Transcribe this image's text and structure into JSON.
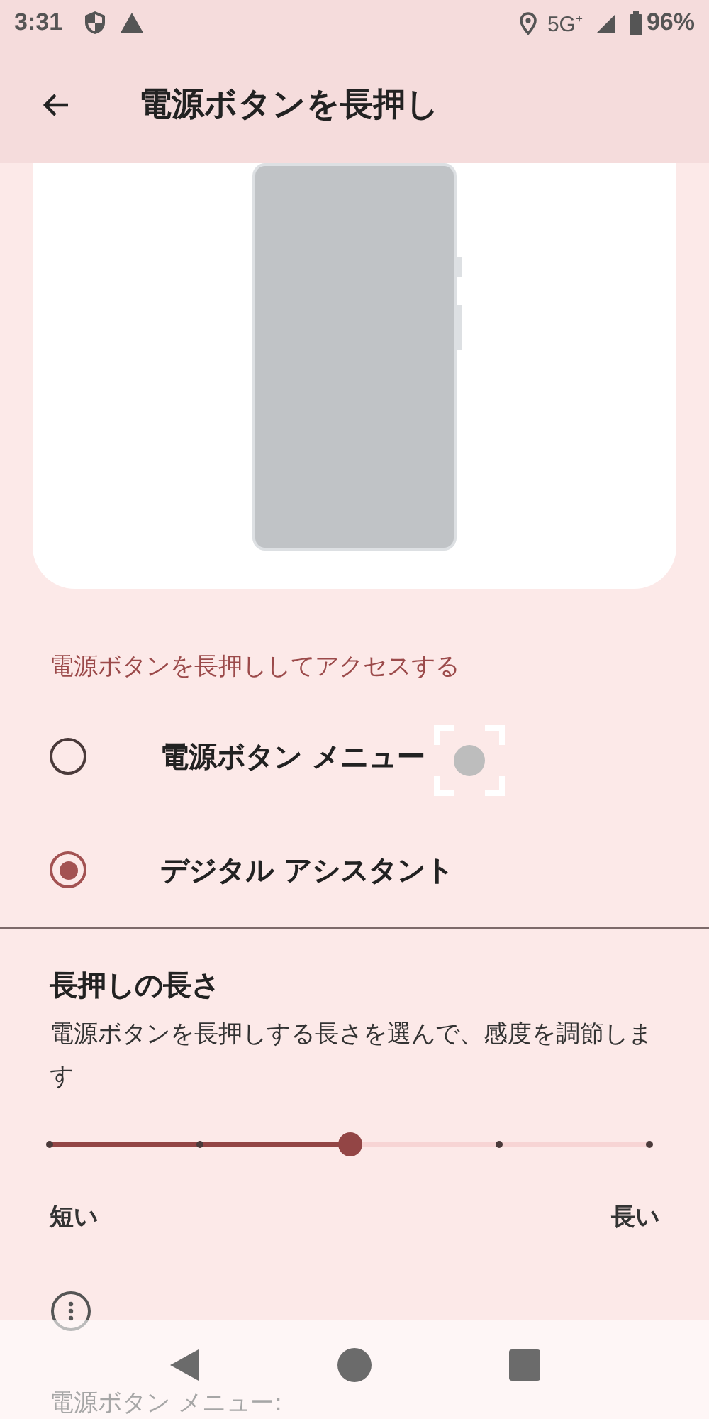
{
  "status_bar": {
    "time": "3:31",
    "network": "5G⁺",
    "battery": "96%"
  },
  "app_bar": {
    "title": "電源ボタンを長押し"
  },
  "illustration": {
    "kind": "phone"
  },
  "section": {
    "title": "電源ボタンを長押ししてアクセスする"
  },
  "options": [
    {
      "label": "電源ボタン メニュー",
      "selected": false
    },
    {
      "label": "デジタル アシスタント",
      "selected": true
    }
  ],
  "duration": {
    "title": "長押しの長さ",
    "description": "電源ボタンを長押しする長さを選んで、感度を調節します",
    "level": 0.5,
    "min_label": "短い",
    "max_label": "長い"
  },
  "footer_note": "電源ボタン メニュー:"
}
